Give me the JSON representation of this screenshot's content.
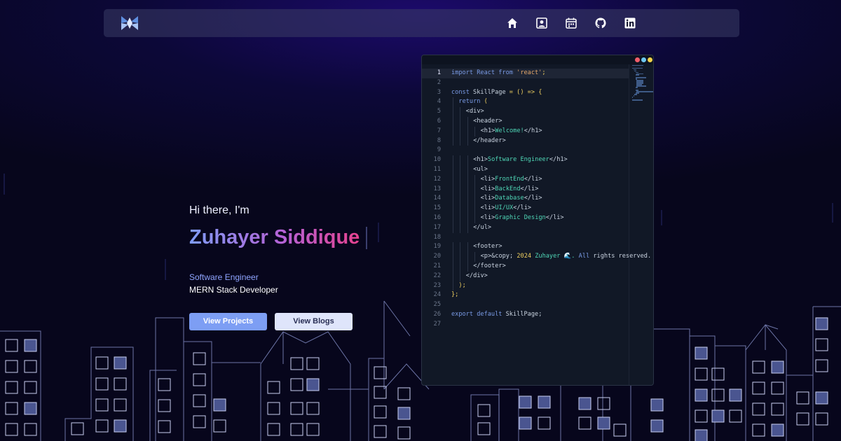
{
  "nav": {
    "logo": "site-logo",
    "icons": [
      {
        "name": "home-icon"
      },
      {
        "name": "profile-icon"
      },
      {
        "name": "calendar-icon"
      },
      {
        "name": "github-icon"
      },
      {
        "name": "linkedin-icon"
      }
    ]
  },
  "hero": {
    "greeting": "Hi there, I'm",
    "name": "Zuhayer Siddique",
    "role_primary": "Software Engineer",
    "role_secondary": "MERN Stack Developer",
    "button_projects": "View Projects",
    "button_blogs": "View Blogs"
  },
  "editor": {
    "lines": [
      {
        "n": "1",
        "indent": 0,
        "parts": [
          [
            "kw",
            "import "
          ],
          [
            "kw",
            "React "
          ],
          [
            "kw",
            "from "
          ],
          [
            "str",
            "'react'"
          ],
          [
            "pun",
            ";"
          ]
        ]
      },
      {
        "n": "2",
        "indent": 0,
        "parts": []
      },
      {
        "n": "3",
        "indent": 0,
        "parts": [
          [
            "kw",
            "const "
          ],
          [
            "txt2",
            "SkillPage "
          ],
          [
            "pun",
            "= () => {"
          ]
        ]
      },
      {
        "n": "4",
        "indent": 1,
        "parts": [
          [
            "kw",
            "return "
          ],
          [
            "pun",
            "("
          ]
        ]
      },
      {
        "n": "5",
        "indent": 2,
        "parts": [
          [
            "tag",
            "<div>"
          ]
        ]
      },
      {
        "n": "6",
        "indent": 3,
        "parts": [
          [
            "tag",
            "<header>"
          ]
        ]
      },
      {
        "n": "7",
        "indent": 4,
        "parts": [
          [
            "tag",
            "<h1>"
          ],
          [
            "txt",
            "Welcome!"
          ],
          [
            "tag",
            "</h1>"
          ]
        ]
      },
      {
        "n": "8",
        "indent": 3,
        "parts": [
          [
            "tag",
            "</header>"
          ]
        ]
      },
      {
        "n": "9",
        "indent": 0,
        "parts": []
      },
      {
        "n": "10",
        "indent": 3,
        "parts": [
          [
            "tag",
            "<h1>"
          ],
          [
            "txt",
            "Software Engineer"
          ],
          [
            "tag",
            "</h1>"
          ]
        ]
      },
      {
        "n": "11",
        "indent": 3,
        "parts": [
          [
            "tag",
            "<ul>"
          ]
        ]
      },
      {
        "n": "12",
        "indent": 4,
        "parts": [
          [
            "tag",
            "<li>"
          ],
          [
            "txt",
            "FrontEnd"
          ],
          [
            "tag",
            "</li>"
          ]
        ]
      },
      {
        "n": "13",
        "indent": 4,
        "parts": [
          [
            "tag",
            "<li>"
          ],
          [
            "txt",
            "BackEnd"
          ],
          [
            "tag",
            "</li>"
          ]
        ]
      },
      {
        "n": "14",
        "indent": 4,
        "parts": [
          [
            "tag",
            "<li>"
          ],
          [
            "txt",
            "Database"
          ],
          [
            "tag",
            "</li>"
          ]
        ]
      },
      {
        "n": "15",
        "indent": 4,
        "parts": [
          [
            "tag",
            "<li>"
          ],
          [
            "txt",
            "UI/UX"
          ],
          [
            "tag",
            "</li>"
          ]
        ]
      },
      {
        "n": "16",
        "indent": 4,
        "parts": [
          [
            "tag",
            "<li>"
          ],
          [
            "txt",
            "Graphic Design"
          ],
          [
            "tag",
            "</li>"
          ]
        ]
      },
      {
        "n": "17",
        "indent": 3,
        "parts": [
          [
            "tag",
            "</ul>"
          ]
        ]
      },
      {
        "n": "18",
        "indent": 0,
        "parts": []
      },
      {
        "n": "19",
        "indent": 3,
        "parts": [
          [
            "tag",
            "<footer>"
          ]
        ]
      },
      {
        "n": "20",
        "indent": 4,
        "parts": [
          [
            "tag",
            "<p>&copy; "
          ],
          [
            "pun",
            "2024 "
          ],
          [
            "txt",
            "Zuhayer 🌊. "
          ],
          [
            "kw",
            "All "
          ],
          [
            "tag",
            "rights reserved."
          ]
        ]
      },
      {
        "n": "21",
        "indent": 3,
        "parts": [
          [
            "tag",
            "</footer>"
          ]
        ]
      },
      {
        "n": "22",
        "indent": 2,
        "parts": [
          [
            "tag",
            "</div>"
          ]
        ]
      },
      {
        "n": "23",
        "indent": 1,
        "parts": [
          [
            "pun",
            ");"
          ]
        ]
      },
      {
        "n": "24",
        "indent": 0,
        "parts": [
          [
            "pun",
            "};"
          ]
        ]
      },
      {
        "n": "25",
        "indent": 0,
        "parts": []
      },
      {
        "n": "26",
        "indent": 0,
        "parts": [
          [
            "kw",
            "export "
          ],
          [
            "kw",
            "default "
          ],
          [
            "tag",
            "SkillPage;"
          ]
        ]
      },
      {
        "n": "27",
        "indent": 0,
        "parts": []
      }
    ]
  },
  "colors": {
    "accent_blue": "#7d9ef4",
    "accent_pink": "#e6428f",
    "building_stroke": "#8f98c8",
    "window_fill": "#4a5590"
  }
}
